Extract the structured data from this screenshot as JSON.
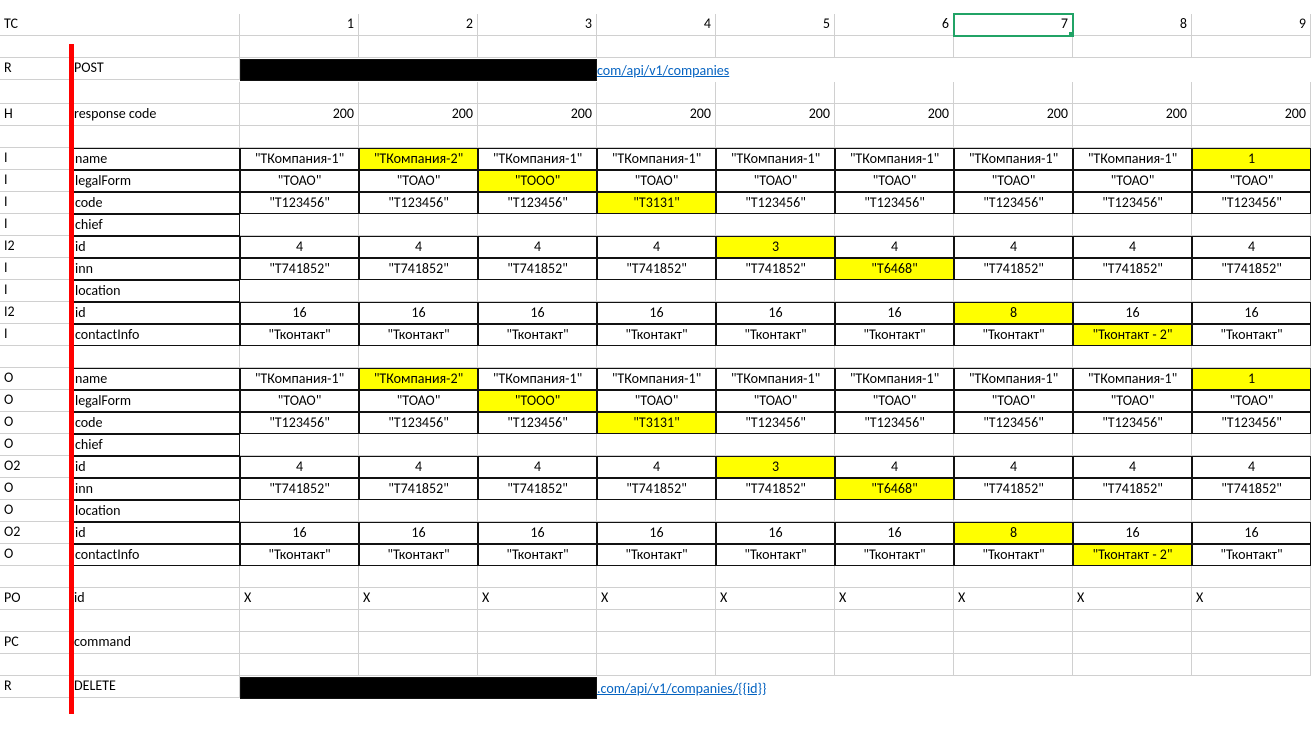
{
  "header": {
    "tc": "TC",
    "cols": [
      "1",
      "2",
      "3",
      "4",
      "5",
      "6",
      "7",
      "8",
      "9"
    ]
  },
  "r": {
    "label": "R",
    "method": "POST",
    "link": "com/api/v1/companies"
  },
  "h": {
    "label": "H",
    "field": "response code",
    "vals": [
      "200",
      "200",
      "200",
      "200",
      "200",
      "200",
      "200",
      "200",
      "200"
    ]
  },
  "in_rows": [
    {
      "tag": "I",
      "field": "name",
      "vals": [
        "\"ТКомпания-1\"",
        "\"ТКомпания-2\"",
        "\"ТКомпания-1\"",
        "\"ТКомпания-1\"",
        "\"ТКомпания-1\"",
        "\"ТКомпания-1\"",
        "\"ТКомпания-1\"",
        "\"ТКомпания-1\"",
        "1"
      ],
      "hl": [
        false,
        true,
        false,
        false,
        false,
        false,
        false,
        false,
        true
      ]
    },
    {
      "tag": "I",
      "field": "legalForm",
      "vals": [
        "\"ТОАО\"",
        "\"ТОАО\"",
        "\"ТООО\"",
        "\"ТОАО\"",
        "\"ТОАО\"",
        "\"ТОАО\"",
        "\"ТОАО\"",
        "\"ТОАО\"",
        "\"ТОАО\""
      ],
      "hl": [
        false,
        false,
        true,
        false,
        false,
        false,
        false,
        false,
        false
      ]
    },
    {
      "tag": "I",
      "field": "code",
      "vals": [
        "\"T123456\"",
        "\"T123456\"",
        "\"T123456\"",
        "\"T3131\"",
        "\"T123456\"",
        "\"T123456\"",
        "\"T123456\"",
        "\"T123456\"",
        "\"T123456\""
      ],
      "hl": [
        false,
        false,
        false,
        true,
        false,
        false,
        false,
        false,
        false
      ]
    },
    {
      "tag": "I",
      "field": "chief",
      "vals": [
        "",
        "",
        "",
        "",
        "",
        "",
        "",
        "",
        ""
      ],
      "hl": [
        false,
        false,
        false,
        false,
        false,
        false,
        false,
        false,
        false
      ],
      "nobox": true
    },
    {
      "tag": "I2",
      "field": "id",
      "vals": [
        "4",
        "4",
        "4",
        "4",
        "3",
        "4",
        "4",
        "4",
        "4"
      ],
      "hl": [
        false,
        false,
        false,
        false,
        true,
        false,
        false,
        false,
        false
      ]
    },
    {
      "tag": "I",
      "field": "inn",
      "vals": [
        "\"T741852\"",
        "\"T741852\"",
        "\"T741852\"",
        "\"T741852\"",
        "\"T741852\"",
        "\"T6468\"",
        "\"T741852\"",
        "\"T741852\"",
        "\"T741852\""
      ],
      "hl": [
        false,
        false,
        false,
        false,
        false,
        true,
        false,
        false,
        false
      ]
    },
    {
      "tag": "I",
      "field": "location",
      "vals": [
        "",
        "",
        "",
        "",
        "",
        "",
        "",
        "",
        ""
      ],
      "hl": [
        false,
        false,
        false,
        false,
        false,
        false,
        false,
        false,
        false
      ],
      "nobox": true
    },
    {
      "tag": "I2",
      "field": "id",
      "vals": [
        "16",
        "16",
        "16",
        "16",
        "16",
        "16",
        "8",
        "16",
        "16"
      ],
      "hl": [
        false,
        false,
        false,
        false,
        false,
        false,
        true,
        false,
        false
      ]
    },
    {
      "tag": "I",
      "field": "contactInfo",
      "vals": [
        "\"Тконтакт\"",
        "\"Тконтакт\"",
        "\"Тконтакт\"",
        "\"Тконтакт\"",
        "\"Тконтакт\"",
        "\"Тконтакт\"",
        "\"Тконтакт\"",
        "\"Тконтакт - 2\"",
        "\"Тконтакт\""
      ],
      "hl": [
        false,
        false,
        false,
        false,
        false,
        false,
        false,
        true,
        false
      ]
    }
  ],
  "out_rows": [
    {
      "tag": "O",
      "field": "name",
      "vals": [
        "\"ТКомпания-1\"",
        "\"ТКомпания-2\"",
        "\"ТКомпания-1\"",
        "\"ТКомпания-1\"",
        "\"ТКомпания-1\"",
        "\"ТКомпания-1\"",
        "\"ТКомпания-1\"",
        "\"ТКомпания-1\"",
        "1"
      ],
      "hl": [
        false,
        true,
        false,
        false,
        false,
        false,
        false,
        false,
        true
      ]
    },
    {
      "tag": "O",
      "field": "legalForm",
      "vals": [
        "\"ТОАО\"",
        "\"ТОАО\"",
        "\"ТООО\"",
        "\"ТОАО\"",
        "\"ТОАО\"",
        "\"ТОАО\"",
        "\"ТОАО\"",
        "\"ТОАО\"",
        "\"ТОАО\""
      ],
      "hl": [
        false,
        false,
        true,
        false,
        false,
        false,
        false,
        false,
        false
      ]
    },
    {
      "tag": "O",
      "field": "code",
      "vals": [
        "\"T123456\"",
        "\"T123456\"",
        "\"T123456\"",
        "\"T3131\"",
        "\"T123456\"",
        "\"T123456\"",
        "\"T123456\"",
        "\"T123456\"",
        "\"T123456\""
      ],
      "hl": [
        false,
        false,
        false,
        true,
        false,
        false,
        false,
        false,
        false
      ]
    },
    {
      "tag": "O",
      "field": "chief",
      "vals": [
        "",
        "",
        "",
        "",
        "",
        "",
        "",
        "",
        ""
      ],
      "hl": [
        false,
        false,
        false,
        false,
        false,
        false,
        false,
        false,
        false
      ],
      "nobox": true
    },
    {
      "tag": "O2",
      "field": "id",
      "vals": [
        "4",
        "4",
        "4",
        "4",
        "3",
        "4",
        "4",
        "4",
        "4"
      ],
      "hl": [
        false,
        false,
        false,
        false,
        true,
        false,
        false,
        false,
        false
      ]
    },
    {
      "tag": "O",
      "field": "inn",
      "vals": [
        "\"T741852\"",
        "\"T741852\"",
        "\"T741852\"",
        "\"T741852\"",
        "\"T741852\"",
        "\"T6468\"",
        "\"T741852\"",
        "\"T741852\"",
        "\"T741852\""
      ],
      "hl": [
        false,
        false,
        false,
        false,
        false,
        true,
        false,
        false,
        false
      ]
    },
    {
      "tag": "O",
      "field": "location",
      "vals": [
        "",
        "",
        "",
        "",
        "",
        "",
        "",
        "",
        ""
      ],
      "hl": [
        false,
        false,
        false,
        false,
        false,
        false,
        false,
        false,
        false
      ],
      "nobox": true
    },
    {
      "tag": "O2",
      "field": "id",
      "vals": [
        "16",
        "16",
        "16",
        "16",
        "16",
        "16",
        "8",
        "16",
        "16"
      ],
      "hl": [
        false,
        false,
        false,
        false,
        false,
        false,
        true,
        false,
        false
      ]
    },
    {
      "tag": "O",
      "field": "contactInfo",
      "vals": [
        "\"Тконтакт\"",
        "\"Тконтакт\"",
        "\"Тконтакт\"",
        "\"Тконтакт\"",
        "\"Тконтакт\"",
        "\"Тконтакт\"",
        "\"Тконтакт\"",
        "\"Тконтакт - 2\"",
        "\"Тконтакт\""
      ],
      "hl": [
        false,
        false,
        false,
        false,
        false,
        false,
        false,
        true,
        false
      ]
    }
  ],
  "po": {
    "label": "PO",
    "field": "id",
    "vals": [
      "X",
      "X",
      "X",
      "X",
      "X",
      "X",
      "X",
      "X",
      "X"
    ]
  },
  "pc": {
    "label": "PC",
    "field": "command"
  },
  "r2": {
    "label": "R",
    "method": "DELETE",
    "link": ".com/api/v1/companies/{{id}}"
  },
  "selected_col": 7
}
